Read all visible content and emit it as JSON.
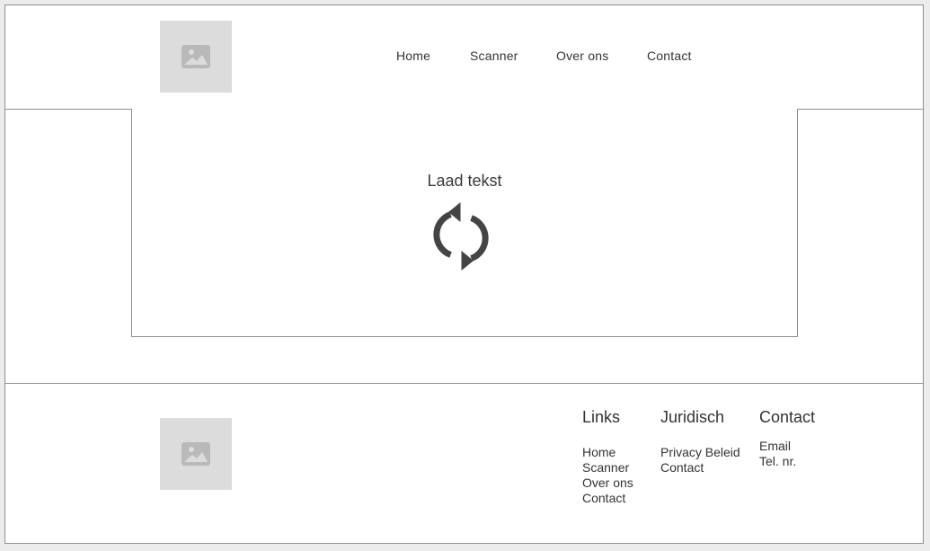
{
  "header": {
    "logo_icon": "image-icon",
    "nav": [
      {
        "label": "Home"
      },
      {
        "label": "Scanner"
      },
      {
        "label": "Over ons"
      },
      {
        "label": "Contact"
      }
    ]
  },
  "main": {
    "loading_text": "Laad tekst",
    "loading_icon": "refresh-icon"
  },
  "footer": {
    "logo_icon": "image-icon",
    "columns": [
      {
        "heading": "Links",
        "items": [
          "Home",
          "Scanner",
          "Over ons",
          "Contact"
        ]
      },
      {
        "heading": "Juridisch",
        "items": [
          "Privacy Beleid",
          "Contact"
        ]
      },
      {
        "heading": "Contact",
        "items": [
          "Email",
          "Tel. nr."
        ]
      }
    ]
  },
  "colors": {
    "border": "#8f8f8f",
    "placeholder": "#dcdcdc",
    "placeholder_icon": "#b9b9b9",
    "icon": "#444444",
    "text": "#333333"
  }
}
